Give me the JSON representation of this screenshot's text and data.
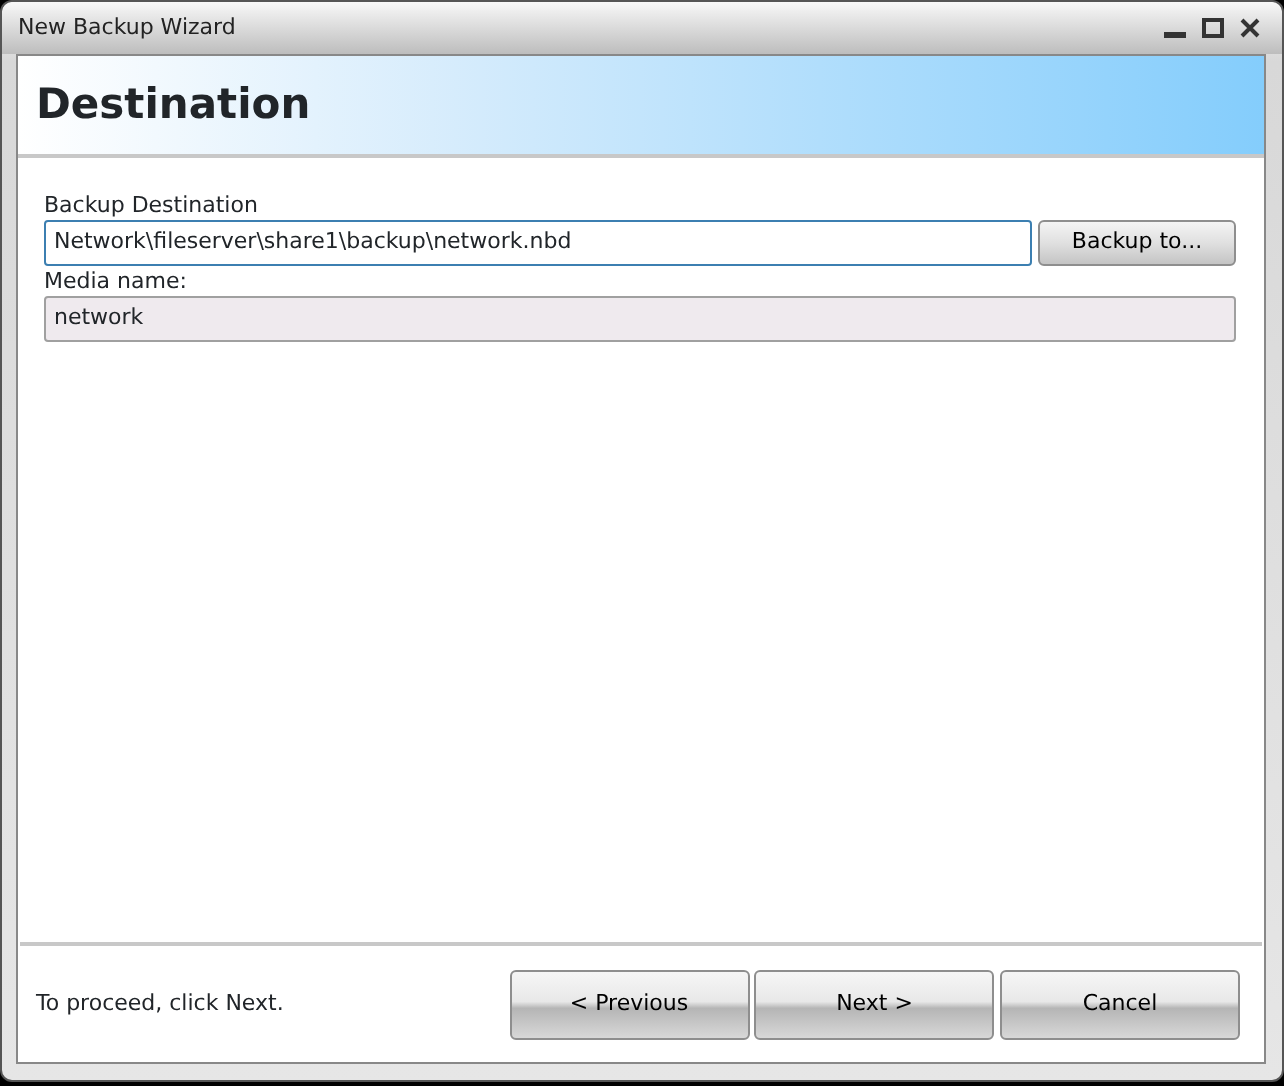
{
  "window": {
    "title": "New Backup Wizard"
  },
  "header": {
    "title": "Destination"
  },
  "fields": [
    {
      "label": "Backup Destination",
      "value": "Network\\fileserver\\share1\\backup\\network.nbd",
      "focused": true,
      "readonly": false,
      "button": "Backup to..."
    },
    {
      "label": "Media name:",
      "value": "network",
      "focused": false,
      "readonly": true
    }
  ],
  "footer": {
    "hint": "To proceed, click Next.",
    "buttons": [
      "< Previous",
      "Next >",
      "Cancel"
    ]
  }
}
